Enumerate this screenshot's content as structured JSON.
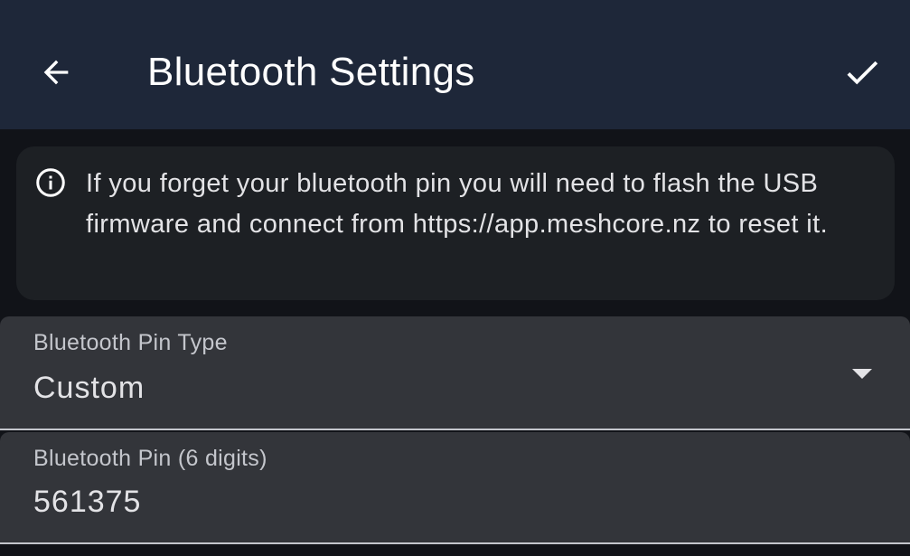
{
  "header": {
    "title": "Bluetooth Settings",
    "back_icon": "arrow-back-icon",
    "confirm_icon": "check-icon"
  },
  "info": {
    "icon": "info-icon",
    "text": "If you forget your bluetooth pin you will need to flash the USB firmware and connect from https://app.meshcore.nz to reset it."
  },
  "pin_type_field": {
    "label": "Bluetooth Pin Type",
    "value": "Custom",
    "icon": "dropdown-arrow-icon"
  },
  "pin_field": {
    "label": "Bluetooth Pin (6 digits)",
    "value": "561375"
  },
  "colors": {
    "app_bar": "#1e2739",
    "background": "#111318",
    "card": "#1d2024",
    "field": "#33353a",
    "text": "#e3e3e6"
  }
}
